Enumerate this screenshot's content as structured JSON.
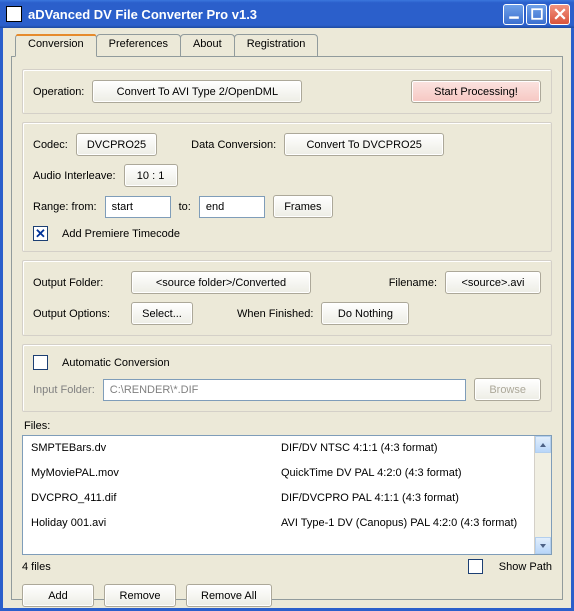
{
  "window": {
    "title": "aDVanced DV File Converter Pro v1.3"
  },
  "tabs": [
    {
      "label": "Conversion",
      "active": true
    },
    {
      "label": "Preferences",
      "active": false
    },
    {
      "label": "About",
      "active": false
    },
    {
      "label": "Registration",
      "active": false
    }
  ],
  "operation": {
    "label": "Operation:",
    "value": "Convert To AVI Type 2/OpenDML",
    "start_button": "Start Processing!"
  },
  "codec": {
    "codec_label": "Codec:",
    "codec_value": "DVCPRO25",
    "dataconv_label": "Data Conversion:",
    "dataconv_value": "Convert To DVCPRO25",
    "audio_label": "Audio Interleave:",
    "audio_value": "10 : 1",
    "range_label": "Range: from:",
    "range_from": "start",
    "range_to_label": "to:",
    "range_to": "end",
    "range_units_btn": "Frames",
    "add_tc_label": "Add Premiere Timecode",
    "add_tc_checked": true
  },
  "output": {
    "folder_label": "Output Folder:",
    "folder_value": "<source folder>/Converted",
    "filename_label": "Filename:",
    "filename_value": "<source>.avi",
    "options_label": "Output Options:",
    "options_btn": "Select...",
    "whenfin_label": "When Finished:",
    "whenfin_value": "Do Nothing"
  },
  "autoconv": {
    "checked": false,
    "label": "Automatic Conversion",
    "input_folder_label": "Input Folder:",
    "input_folder_value": "C:\\RENDER\\*.DIF",
    "browse_btn": "Browse"
  },
  "files": {
    "label": "Files:",
    "rows": [
      {
        "name": "SMPTEBars.dv",
        "desc": "DIF/DV NTSC 4:1:1 (4:3 format)"
      },
      {
        "name": "MyMoviePAL.mov",
        "desc": "QuickTime DV PAL 4:2:0 (4:3 format)"
      },
      {
        "name": "DVCPRO_411.dif",
        "desc": "DIF/DVCPRO PAL 4:1:1 (4:3 format)"
      },
      {
        "name": "Holiday 001.avi",
        "desc": "AVI Type-1 DV (Canopus) PAL 4:2:0 (4:3 format)"
      }
    ],
    "count_text": "4 files",
    "show_path_label": "Show Path",
    "show_path_checked": false,
    "add_btn": "Add",
    "remove_btn": "Remove",
    "removeall_btn": "Remove All"
  }
}
